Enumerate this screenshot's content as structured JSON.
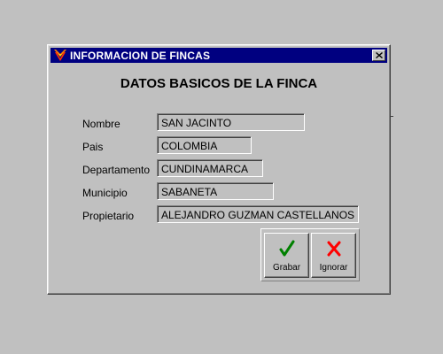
{
  "window": {
    "title": "INFORMACION DE FINCAS",
    "icon": "farm-emblem-icon",
    "close_icon": "close-icon"
  },
  "form": {
    "heading": "DATOS BASICOS DE LA FINCA",
    "fields": [
      {
        "label": "Nombre",
        "value": "SAN JACINTO"
      },
      {
        "label": "Pais",
        "value": "COLOMBIA"
      },
      {
        "label": "Departamento",
        "value": "CUNDINAMARCA"
      },
      {
        "label": "Municipio",
        "value": "SABANETA"
      },
      {
        "label": "Propietario",
        "value": "ALEJANDRO GUZMAN CASTELLANOS"
      }
    ]
  },
  "buttons": {
    "save": {
      "label": "Grabar",
      "icon": "checkmark-icon",
      "color": "#008000"
    },
    "ignore": {
      "label": "Ignorar",
      "icon": "cross-icon",
      "color": "#ff0000"
    }
  },
  "colors": {
    "titlebar": "#000080",
    "face": "#c0c0c0"
  }
}
